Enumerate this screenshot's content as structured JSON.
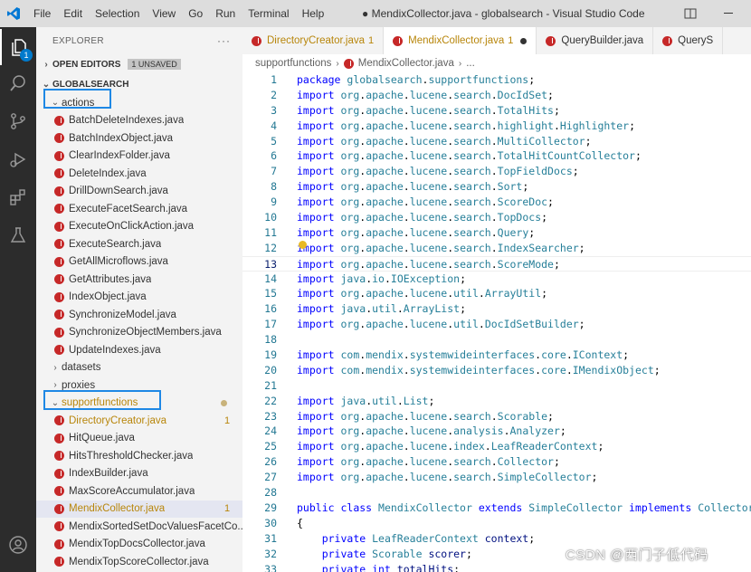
{
  "titlebar": {
    "menu": [
      "File",
      "Edit",
      "Selection",
      "View",
      "Go",
      "Run",
      "Terminal",
      "Help"
    ],
    "title": "● MendixCollector.java - globalsearch - Visual Studio Code"
  },
  "activity": {
    "explorer_badge": "1"
  },
  "sidebar": {
    "title": "EXPLORER",
    "more": "···",
    "open_editors": "OPEN EDITORS",
    "unsaved_badge": "1 UNSAVED",
    "workspace": "GLOBALSEARCH",
    "folders": {
      "actions": "actions",
      "datasets": "datasets",
      "proxies": "proxies",
      "supportfunctions": "supportfunctions"
    },
    "actions_files": [
      "BatchDeleteIndexes.java",
      "BatchIndexObject.java",
      "ClearIndexFolder.java",
      "DeleteIndex.java",
      "DrillDownSearch.java",
      "ExecuteFacetSearch.java",
      "ExecuteOnClickAction.java",
      "ExecuteSearch.java",
      "GetAllMicroflows.java",
      "GetAttributes.java",
      "IndexObject.java",
      "SynchronizeModel.java",
      "SynchronizeObjectMembers.java",
      "UpdateIndexes.java"
    ],
    "support_files": [
      {
        "name": "DirectoryCreator.java",
        "count": "1",
        "modified": true
      },
      {
        "name": "HitQueue.java",
        "count": "",
        "modified": false
      },
      {
        "name": "HitsThresholdChecker.java",
        "count": "",
        "modified": false
      },
      {
        "name": "IndexBuilder.java",
        "count": "",
        "modified": false
      },
      {
        "name": "MaxScoreAccumulator.java",
        "count": "",
        "modified": false
      },
      {
        "name": "MendixCollector.java",
        "count": "1",
        "modified": true
      },
      {
        "name": "MendixSortedSetDocValuesFacetCo...",
        "count": "",
        "modified": false
      },
      {
        "name": "MendixTopDocsCollector.java",
        "count": "",
        "modified": false
      },
      {
        "name": "MendixTopScoreCollector.java",
        "count": "",
        "modified": false
      }
    ]
  },
  "tabs": [
    {
      "label": "DirectoryCreator.java",
      "num": "1"
    },
    {
      "label": "MendixCollector.java",
      "num": "1"
    },
    {
      "label": "QueryBuilder.java",
      "num": ""
    },
    {
      "label": "QueryS",
      "num": ""
    }
  ],
  "breadcrumb": {
    "folder": "supportfunctions",
    "file": "MendixCollector.java",
    "more": "..."
  },
  "editor": {
    "current_line": 13,
    "lines": [
      {
        "n": "1",
        "t": "package globalsearch.supportfunctions;"
      },
      {
        "n": "2",
        "t": "import org.apache.lucene.search.DocIdSet;"
      },
      {
        "n": "3",
        "t": "import org.apache.lucene.search.TotalHits;"
      },
      {
        "n": "4",
        "t": "import org.apache.lucene.search.highlight.Highlighter;"
      },
      {
        "n": "5",
        "t": "import org.apache.lucene.search.MultiCollector;"
      },
      {
        "n": "6",
        "t": "import org.apache.lucene.search.TotalHitCountCollector;"
      },
      {
        "n": "7",
        "t": "import org.apache.lucene.search.TopFieldDocs;"
      },
      {
        "n": "8",
        "t": "import org.apache.lucene.search.Sort;"
      },
      {
        "n": "9",
        "t": "import org.apache.lucene.search.ScoreDoc;"
      },
      {
        "n": "10",
        "t": "import org.apache.lucene.search.TopDocs;"
      },
      {
        "n": "11",
        "t": "import org.apache.lucene.search.Query;"
      },
      {
        "n": "12",
        "t": "import org.apache.lucene.search.IndexSearcher;"
      },
      {
        "n": "13",
        "t": "import org.apache.lucene.search.ScoreMode;"
      },
      {
        "n": "14",
        "t": "import java.io.IOException;"
      },
      {
        "n": "15",
        "t": "import org.apache.lucene.util.ArrayUtil;"
      },
      {
        "n": "16",
        "t": "import java.util.ArrayList;"
      },
      {
        "n": "17",
        "t": "import org.apache.lucene.util.DocIdSetBuilder;"
      },
      {
        "n": "18",
        "t": ""
      },
      {
        "n": "19",
        "t": "import com.mendix.systemwideinterfaces.core.IContext;"
      },
      {
        "n": "20",
        "t": "import com.mendix.systemwideinterfaces.core.IMendixObject;"
      },
      {
        "n": "21",
        "t": ""
      },
      {
        "n": "22",
        "t": "import java.util.List;"
      },
      {
        "n": "23",
        "t": "import org.apache.lucene.search.Scorable;"
      },
      {
        "n": "24",
        "t": "import org.apache.lucene.analysis.Analyzer;"
      },
      {
        "n": "25",
        "t": "import org.apache.lucene.index.LeafReaderContext;"
      },
      {
        "n": "26",
        "t": "import org.apache.lucene.search.Collector;"
      },
      {
        "n": "27",
        "t": "import org.apache.lucene.search.SimpleCollector;"
      },
      {
        "n": "28",
        "t": ""
      },
      {
        "n": "29",
        "t": "public class MendixCollector extends SimpleCollector implements Collector"
      },
      {
        "n": "30",
        "t": "{"
      },
      {
        "n": "31",
        "t": "    private LeafReaderContext context;"
      },
      {
        "n": "32",
        "t": "    private Scorable scorer;"
      },
      {
        "n": "33",
        "t": "    private int totalHits;"
      }
    ]
  },
  "watermark": "CSDN @西门子低代码",
  "colors": {
    "accent": "#007acc",
    "highlight_box": "#1e88e5",
    "modified": "#b8860b",
    "java_icon": "#c62828"
  }
}
